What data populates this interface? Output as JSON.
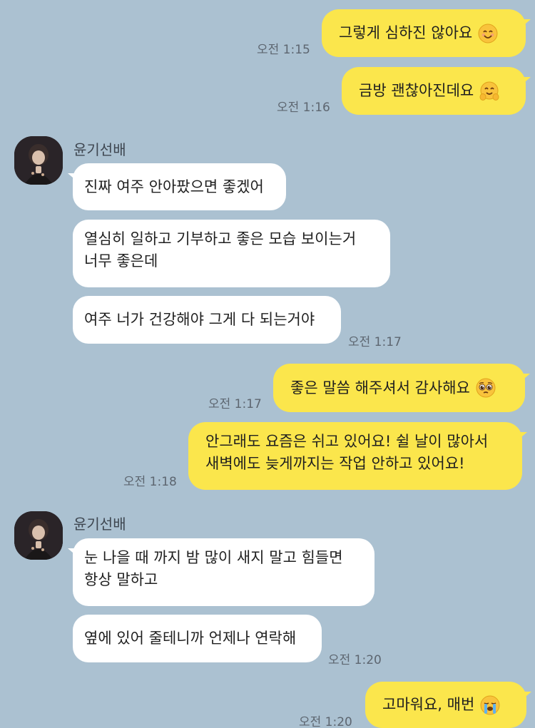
{
  "chat": {
    "contact_name": "윤기선배",
    "messages": [
      {
        "from": "me",
        "text": "그렇게 심하진 않아요",
        "emoji": "smiling-face-icon",
        "time": "오전 1:15"
      },
      {
        "from": "me",
        "text": "금방 괜찮아진데요",
        "emoji": "hugging-face-icon",
        "time": "오전 1:16"
      },
      {
        "from": "them",
        "text": "진짜 여주 안아팠으면 좋겠어"
      },
      {
        "from": "them",
        "lines": [
          "열심히 일하고 기부하고 좋은 모습 보이는거",
          "너무 좋은데"
        ]
      },
      {
        "from": "them",
        "text": "여주 너가 건강해야 그게 다 되는거야",
        "time": "오전 1:17"
      },
      {
        "from": "me",
        "text": "좋은 말씀 해주셔서 감사해요",
        "emoji": "pleading-face-icon",
        "time": "오전 1:17"
      },
      {
        "from": "me",
        "lines": [
          "안그래도 요즘은 쉬고 있어요! 쉴 날이 많아서",
          "새벽에도 늦게까지는 작업 안하고 있어요!"
        ],
        "time": "오전 1:18"
      },
      {
        "from": "them",
        "lines": [
          "눈 나을 때 까지 밤 많이 새지 말고 힘들면",
          "항상 말하고"
        ]
      },
      {
        "from": "them",
        "text": "옆에 있어 줄테니까 언제나 연락해",
        "time": "오전 1:20"
      },
      {
        "from": "me",
        "text": "고마워요, 매번",
        "emoji": "crying-face-icon",
        "time": "오전 1:20"
      }
    ]
  },
  "colors": {
    "background": "#abc1d1",
    "my_bubble": "#fbe64c",
    "their_bubble": "#ffffff"
  }
}
